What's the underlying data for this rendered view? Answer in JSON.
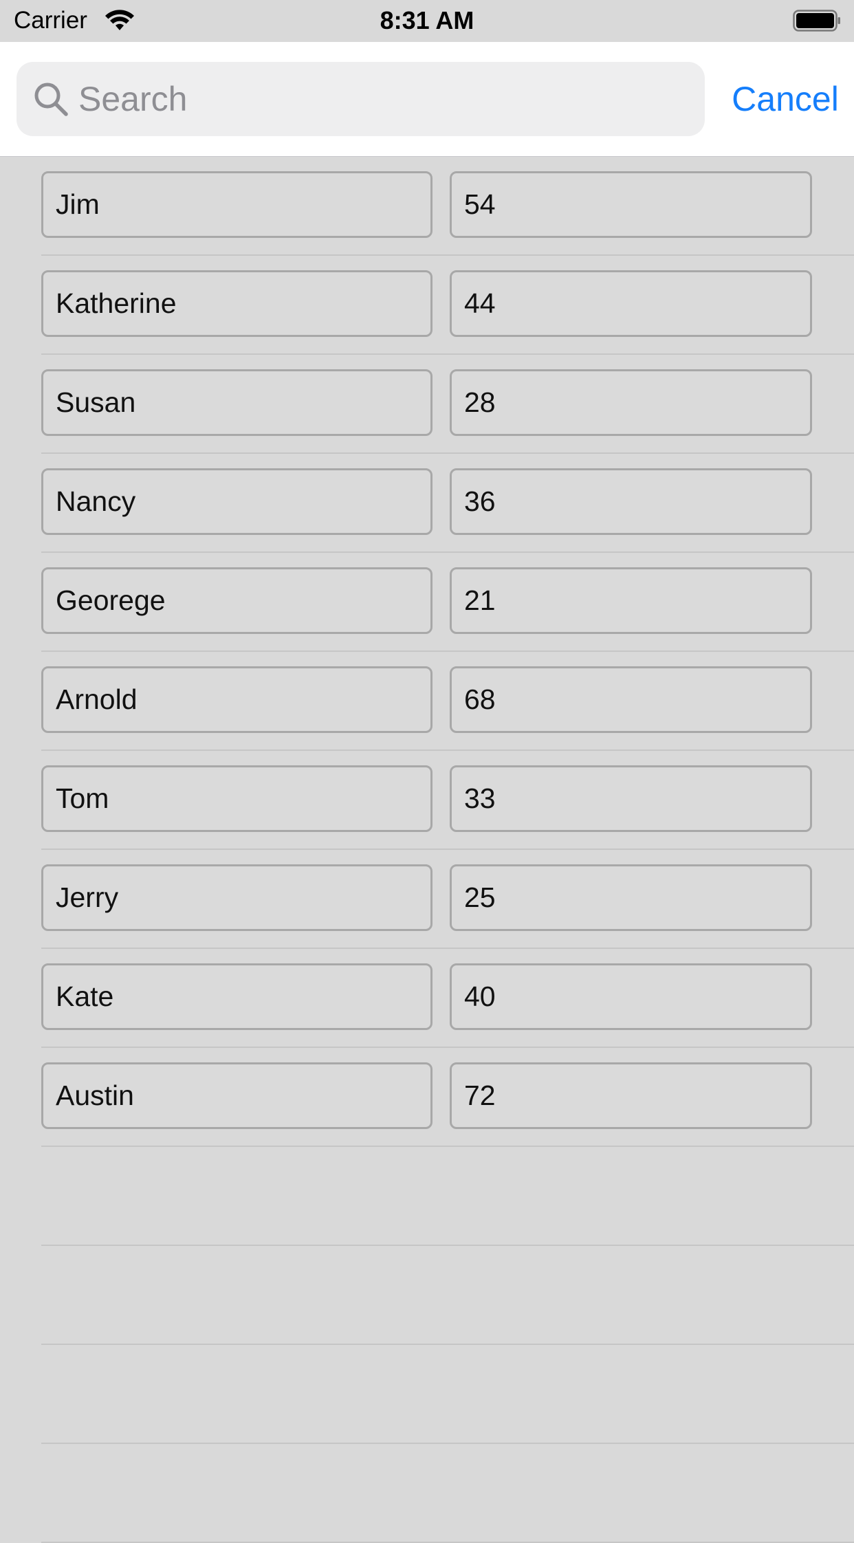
{
  "status_bar": {
    "carrier": "Carrier",
    "time": "8:31 AM",
    "wifi_icon": "wifi-icon",
    "battery_icon": "battery-icon"
  },
  "search": {
    "placeholder": "Search",
    "value": "",
    "icon": "magnifying-glass-icon",
    "cancel_label": "Cancel"
  },
  "colors": {
    "accent": "#157efb",
    "background": "#d9d9d9",
    "header_background": "#ffffff",
    "search_field_background": "#eeeeef",
    "placeholder": "#8e8e93"
  },
  "rows": [
    {
      "name": "Jim",
      "age": "54"
    },
    {
      "name": "Katherine",
      "age": "44"
    },
    {
      "name": "Susan",
      "age": "28"
    },
    {
      "name": "Nancy",
      "age": "36"
    },
    {
      "name": "Georege",
      "age": "21"
    },
    {
      "name": "Arnold",
      "age": "68"
    },
    {
      "name": "Tom",
      "age": "33"
    },
    {
      "name": "Jerry",
      "age": "25"
    },
    {
      "name": "Kate",
      "age": "40"
    },
    {
      "name": "Austin",
      "age": "72"
    }
  ],
  "empty_rows": 4
}
